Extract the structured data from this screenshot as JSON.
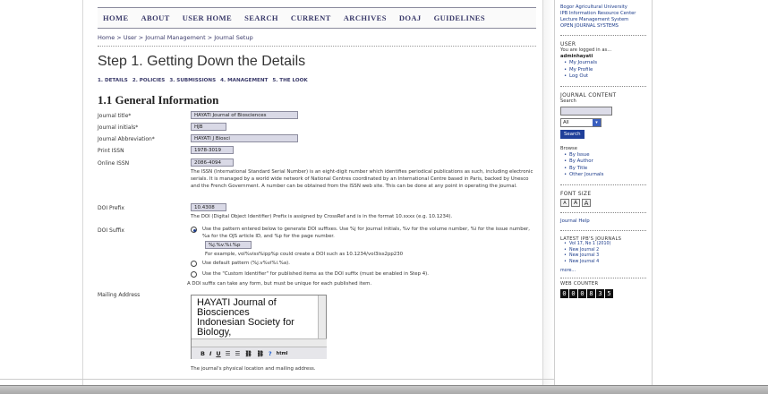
{
  "nav": {
    "items": [
      "HOME",
      "ABOUT",
      "USER HOME",
      "SEARCH",
      "CURRENT",
      "ARCHIVES",
      "DOAJ",
      "GUIDELINES"
    ]
  },
  "breadcrumb": {
    "home": "Home",
    "user": "User",
    "journal_management": "Journal Management",
    "journal_setup": "Journal Setup",
    "separator": ">"
  },
  "page": {
    "title": "Step 1. Getting Down the Details",
    "steps": [
      "1. DETAILS",
      "2. POLICIES",
      "3. SUBMISSIONS",
      "4. MANAGEMENT",
      "5. THE LOOK"
    ],
    "section_title": "1.1 General Information"
  },
  "form": {
    "journal_title": {
      "label": "Journal title*",
      "value": "HAYATI Journal of Biosciences"
    },
    "journal_initials": {
      "label": "Journal initials*",
      "value": "HJB"
    },
    "journal_abbreviation": {
      "label": "Journal Abbreviation*",
      "value": "HAYATI J Biosci"
    },
    "print_issn": {
      "label": "Print ISSN",
      "value": "1978-3019"
    },
    "online_issn": {
      "label": "Online ISSN",
      "value": "2086-4094"
    },
    "issn_help": "The ISSN (International Standard Serial Number) is an eight-digit number which identifies periodical publications as such, including electronic serials. It is managed by a world wide network of National Centres coordinated by an International Centre based in Paris, backed by Unesco and the French Government. A number can be obtained from the ISSN web site. This can be done at any point in operating the journal.",
    "doi_prefix": {
      "label": "DOI Prefix",
      "value": "10.4308"
    },
    "doi_prefix_help": "The DOI (Digital Object Identifier) Prefix is assigned by CrossRef and is in the format 10.xxxx (e.g. 10.1234).",
    "doi_suffix": {
      "label": "DOI Suffix",
      "option_pattern": "Use the pattern entered below to generate DOI suffixes. Use %j for journal initials, %v for the volume number, %i for the issue number, %a for the OJS article ID, and %p for the page number.",
      "pattern_value": "%j.%v.%i.%p",
      "pattern_example": "For example, vol%viss%ipp%p could create a DOI such as 10.1234/vol3iss2pp230",
      "option_default": "Use default pattern (%j.v%vi%i.%a).",
      "option_custom": "Use the \"Custom Identifier\" for published items as the DOI suffix (must be enabled in Step 4).",
      "note": "A DOI suffix can take any form, but must be unique for each published item."
    },
    "mailing_address": {
      "label": "Mailing Address",
      "lines": [
        "HAYATI Journal of",
        "Biosciences",
        "Indonesian Society for",
        "Biology,"
      ],
      "help": "The journal's physical location and mailing address."
    },
    "toolbar": [
      "B",
      "I",
      "U",
      "☰",
      "☰",
      "⛓",
      "⛓",
      "?",
      "html"
    ]
  },
  "sidebar": {
    "institution": [
      "Bogor Agricultural University",
      "IPB Information Resource Center",
      "Lecture Management System",
      "OPEN JOURNAL SYSTEMS"
    ],
    "user_head": "USER",
    "logged_in": "You are logged in as...",
    "username": "adminhayati",
    "user_links": [
      "My Journals",
      "My Profile",
      "Log Out"
    ],
    "journal_content_head": "JOURNAL CONTENT",
    "search_label": "Search",
    "search_scope": "All",
    "search_button": "Search",
    "browse_label": "Browse",
    "browse_links": [
      "By Issue",
      "By Author",
      "By Title",
      "Other Journals"
    ],
    "font_size_head": "FONT SIZE",
    "font_size_buttons": [
      "A",
      "A",
      "A"
    ],
    "journal_help": "Journal Help",
    "latest_head": "LATEST IPB'S JOURNALS",
    "latest_links": [
      "Vol 17, No 1 (2010)",
      "New Journal 2",
      "New Journal 3",
      "New Journal 4"
    ],
    "more": "more...",
    "counter_head": "WEB COUNTER",
    "counter_digits": [
      "0",
      "0",
      "0",
      "8",
      "3",
      "5"
    ]
  },
  "colors": {
    "nav_text": "#3a3a6a",
    "link": "#1a3a8a",
    "input_bg": "#d9d9e6",
    "search_button": "#1f3f9a"
  }
}
